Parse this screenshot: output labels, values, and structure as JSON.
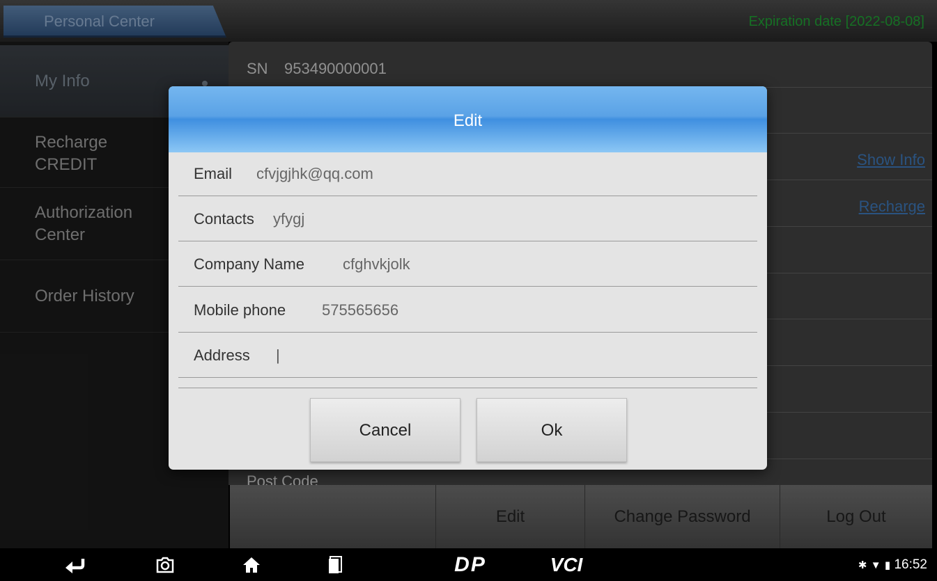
{
  "topbar": {
    "tab": "Personal Center",
    "expiration": "Expiration date [2022-08-08]"
  },
  "sidebar": {
    "items": [
      {
        "label": "My Info",
        "active": true
      },
      {
        "label": "Recharge CREDIT"
      },
      {
        "label": "Authorization Center"
      },
      {
        "label": "Order History"
      }
    ]
  },
  "info": {
    "sn_label": "SN",
    "sn_value": "953490000001",
    "show_info": "Show Info",
    "recharge": "Recharge",
    "post_code_label": "Post Code"
  },
  "actions": {
    "edit": "Edit",
    "change_password": "Change Password",
    "log_out": "Log Out"
  },
  "dialog": {
    "title": "Edit",
    "fields": [
      {
        "label": "Email",
        "value": "cfvjgjhk@qq.com"
      },
      {
        "label": "Contacts",
        "value": "yfygj"
      },
      {
        "label": "Company Name",
        "value": "cfghvkjolk"
      },
      {
        "label": "Mobile phone",
        "value": "575565656"
      },
      {
        "label": "Address",
        "value": "|"
      }
    ],
    "cancel": "Cancel",
    "ok": "Ok"
  },
  "navbar": {
    "dp": "DP",
    "vci": "VCI",
    "time": "16:52"
  },
  "colors": {
    "accent": "#3f8fe0",
    "expiration": "#1f9c33",
    "link": "#3b74b3"
  }
}
